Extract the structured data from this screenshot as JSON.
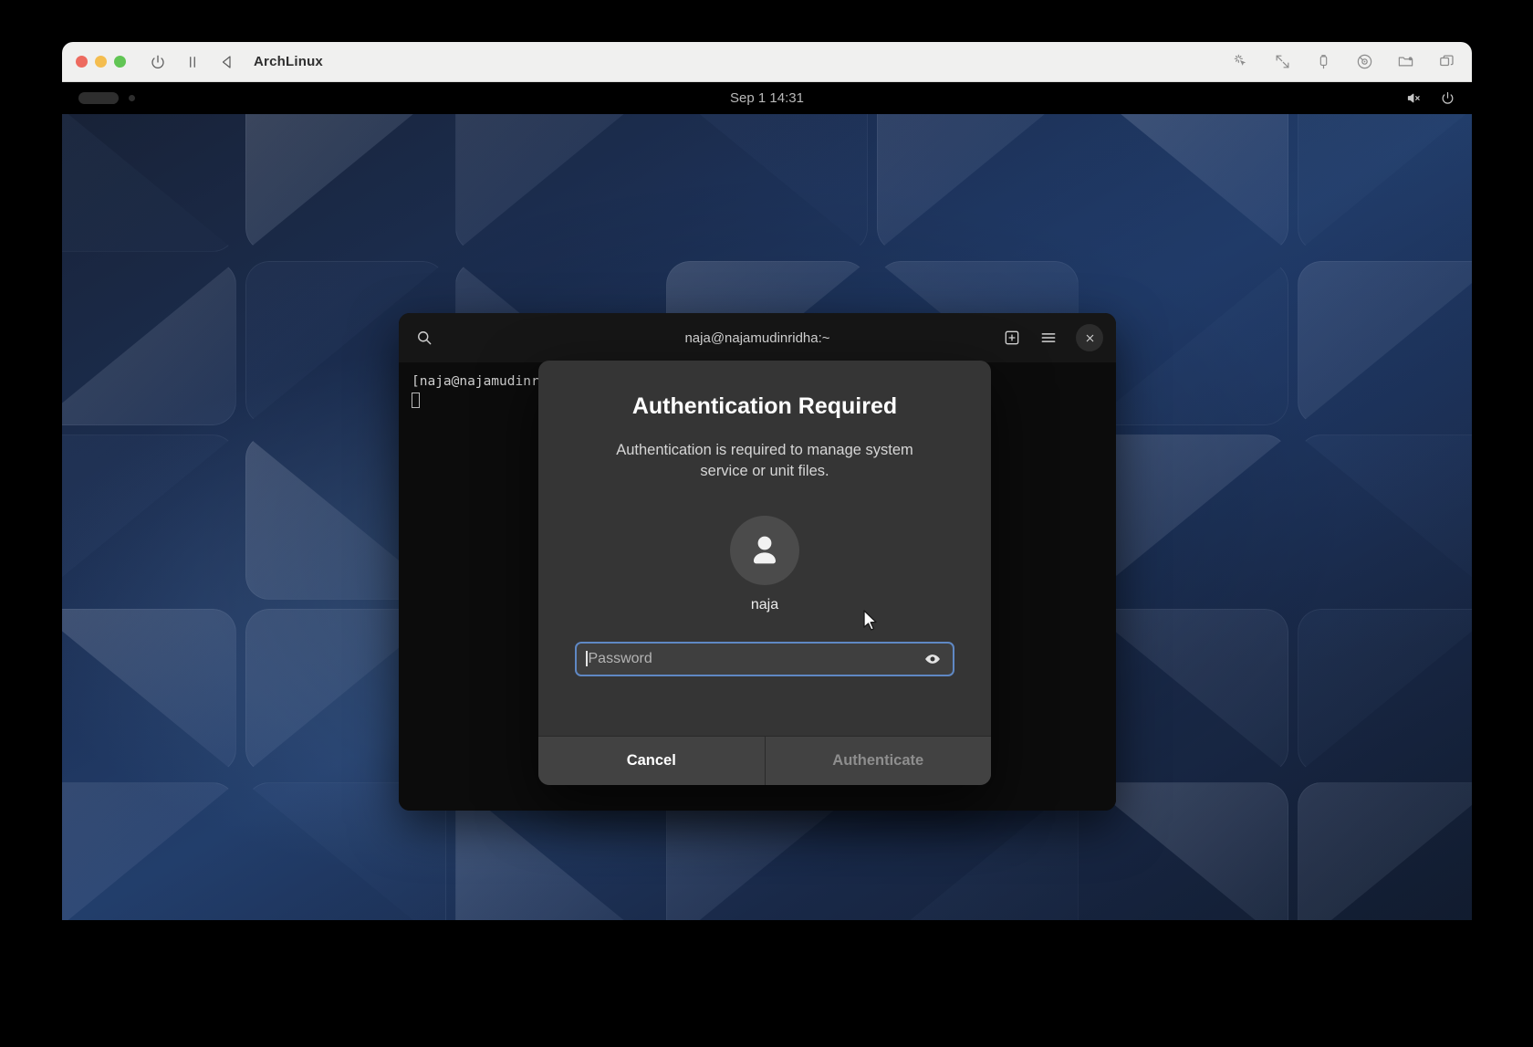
{
  "vm_window": {
    "title": "ArchLinux",
    "traffic_lights": [
      "close",
      "minimize",
      "maximize"
    ],
    "left_icons": [
      "power-icon",
      "pause-icon",
      "back-icon"
    ],
    "right_icons": [
      "pointer-icon",
      "resize-icon",
      "usb-icon",
      "disc-icon",
      "shared-folder-icon",
      "windows-icon"
    ]
  },
  "gnome": {
    "activities_label": "",
    "clock": "Sep 1  14:31",
    "status_icons": [
      "volume-muted-icon",
      "power-icon"
    ]
  },
  "terminal": {
    "title": "naja@najamudinridha:~",
    "search_icon": "search-icon",
    "new_tab_icon": "new-tab-icon",
    "menu_icon": "hamburger-menu-icon",
    "close_icon": "close-icon",
    "prompt_line": "[naja@najamudinr",
    "cursor": "block-cursor"
  },
  "auth_dialog": {
    "title": "Authentication Required",
    "message": "Authentication is required to manage system service or unit files.",
    "avatar_icon": "person-avatar-icon",
    "username": "naja",
    "password": {
      "value": "",
      "placeholder": "Password",
      "reveal_icon": "eye-icon"
    },
    "cancel_label": "Cancel",
    "authenticate_label": "Authenticate",
    "accent_color": "#5f88c4",
    "background_color": "#353535"
  }
}
